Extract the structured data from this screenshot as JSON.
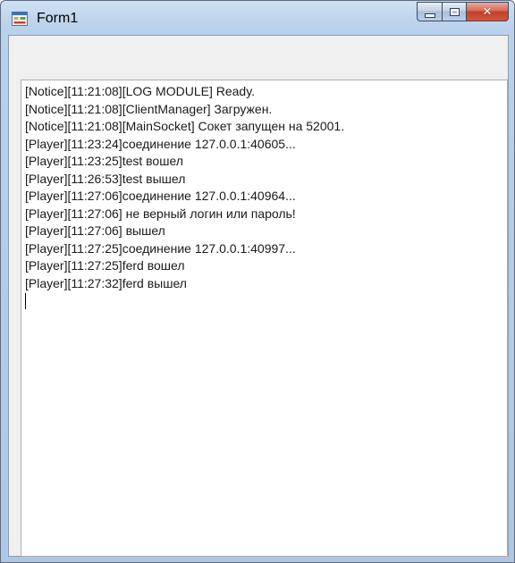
{
  "window": {
    "title": "Form1",
    "controls": {
      "minimize": "minimize-icon",
      "maximize": "maximize-icon",
      "close": "close-icon",
      "close_glyph": "✕"
    }
  },
  "log": {
    "lines": [
      "[Notice][11:21:08][LOG MODULE] Ready.",
      "[Notice][11:21:08][ClientManager] Загружен.",
      "[Notice][11:21:08][MainSocket] Сокет запущен на 52001.",
      "[Player][11:23:24]соединение 127.0.0.1:40605...",
      "[Player][11:23:25]test вошел",
      "[Player][11:26:53]test вышел",
      "[Player][11:27:06]соединение 127.0.0.1:40964...",
      "[Player][11:27:06] не верный логин или пароль!",
      "[Player][11:27:06] вышел",
      "[Player][11:27:25]соединение 127.0.0.1:40997...",
      "[Player][11:27:25]ferd вошел",
      "[Player][11:27:32]ferd вышел"
    ]
  }
}
